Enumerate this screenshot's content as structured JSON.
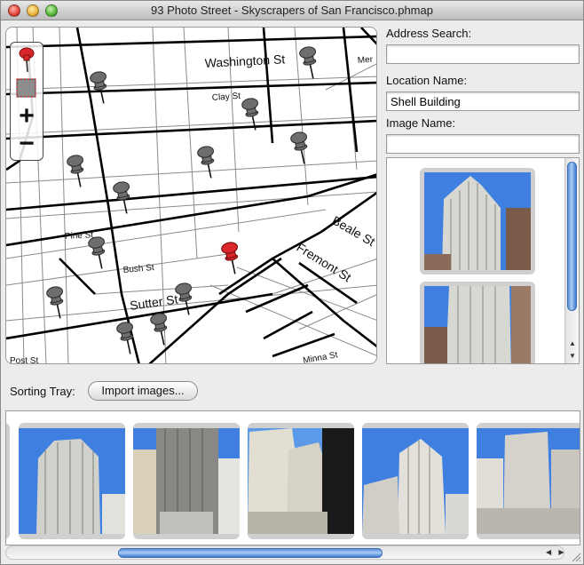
{
  "window": {
    "title": "93 Photo Street - Skyscrapers of San Francisco.phmap"
  },
  "map": {
    "streets": [
      "Washington St",
      "Mer",
      "Clay St",
      "Pine St",
      "Bush St",
      "Sutter St",
      "Post St",
      "Beale St",
      "Fremont St",
      "Minna St"
    ],
    "tools": [
      "pin-tool-icon",
      "select-tool-icon",
      "zoom-in-icon",
      "zoom-out-icon"
    ],
    "zoom_in_glyph": "+",
    "zoom_out_glyph": "−",
    "pin_color_default": "#6e6e6e",
    "pin_color_selected": "#d8262a"
  },
  "fields": {
    "address_label": "Address Search:",
    "address_value": "",
    "location_label": "Location Name:",
    "location_value": "Shell Building",
    "image_label": "Image Name:",
    "image_value": ""
  },
  "sorting_tray": {
    "label": "Sorting Tray:",
    "import_button": "Import images..."
  },
  "colors": {
    "scroll_accent": "#5a8fd8",
    "sky": "#3f7fe0"
  }
}
